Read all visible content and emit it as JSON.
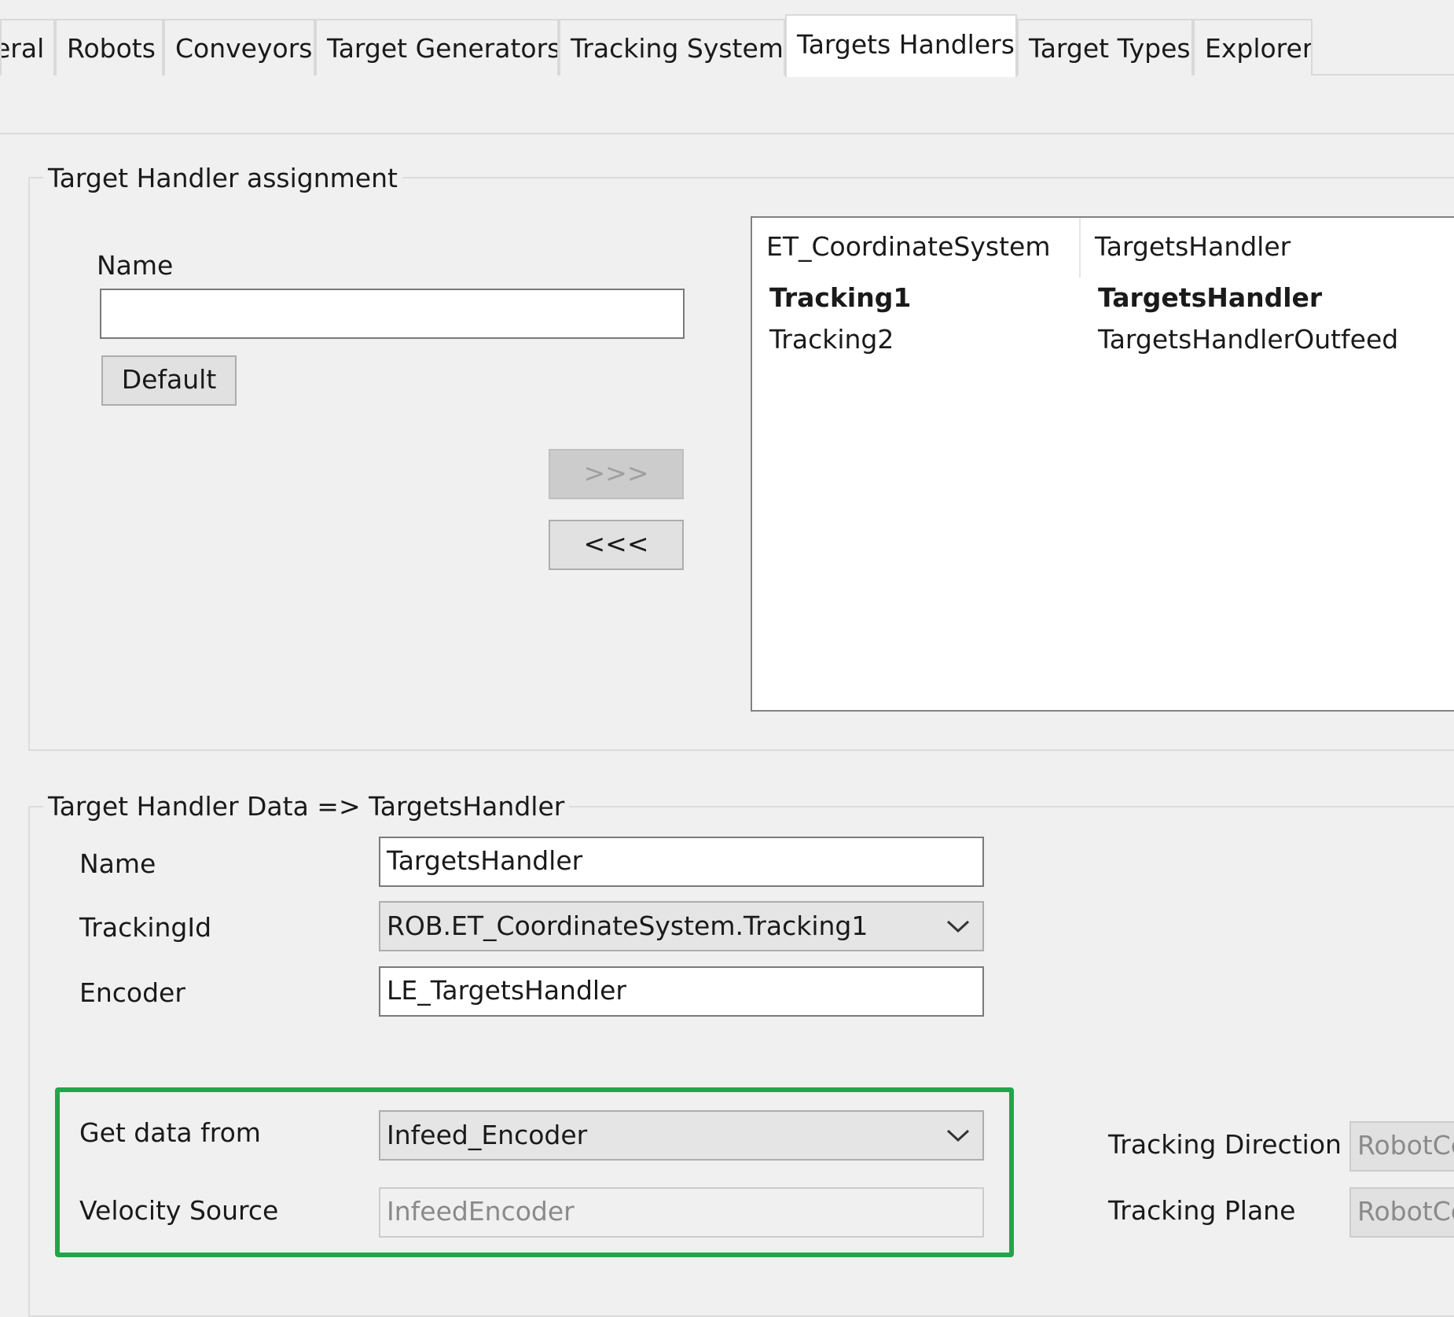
{
  "tabs": [
    "eral",
    "Robots",
    "Conveyors",
    "Target Generators",
    "Tracking Systems",
    "Targets Handlers",
    "Target Types",
    "Explorer"
  ],
  "assignment": {
    "legend": "Target Handler assignment",
    "name_label": "Name",
    "name_value": "",
    "default_label": "Default",
    "add_label": ">>>",
    "remove_label": "<<<",
    "columns": [
      "ET_CoordinateSystem",
      "TargetsHandler"
    ],
    "rows": [
      [
        "Tracking1",
        "TargetsHandler"
      ],
      [
        "Tracking2",
        "TargetsHandlerOutfeed"
      ]
    ]
  },
  "data": {
    "legend": "Target Handler Data => TargetsHandler",
    "name_label": "Name",
    "name_value": "TargetsHandler",
    "tracking_label": "TrackingId",
    "tracking_value": "ROB.ET_CoordinateSystem.Tracking1",
    "encoder_label": "Encoder",
    "encoder_value": "LE_TargetsHandler",
    "getdata_label": "Get data from",
    "getdata_value": "Infeed_Encoder",
    "velocity_label": "Velocity Source",
    "velocity_value": "InfeedEncoder",
    "direction_label": "Tracking Direction",
    "direction_value": "RobotCe",
    "plane_label": "Tracking Plane",
    "plane_value": "RobotCe"
  },
  "colors": {
    "highlight": "#1fa64a",
    "selected_tab": "#ffffff",
    "background": "#f0f0f0"
  },
  "icons": [
    "chevron-down-icon"
  ]
}
